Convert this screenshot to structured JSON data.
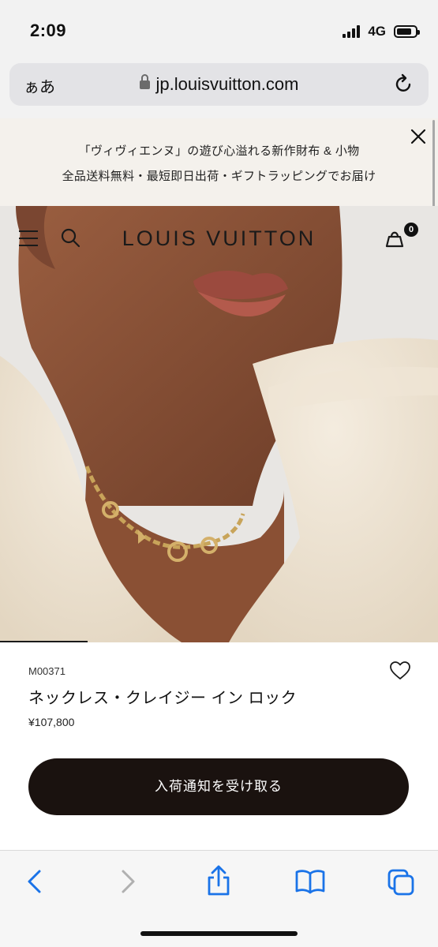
{
  "status_bar": {
    "time": "2:09",
    "network": "4G",
    "signal_bars": 4,
    "battery_level": 0.8
  },
  "browser": {
    "text_size_button": "ぁあ",
    "url": "jp.louisvuitton.com",
    "icons": {
      "lock": "lock-icon",
      "reload": "reload-icon"
    }
  },
  "promo_banner": {
    "line1": "「ヴィヴィエンヌ」の遊び心溢れる新作財布 & 小物",
    "line2": "全品送料無料・最短即日出荷・ギフトラッピングでお届け",
    "close_icon": "close-icon"
  },
  "site_header": {
    "logo": "LOUIS VUITTON",
    "cart_count": "0",
    "icons": {
      "menu": "menu-icon",
      "search": "search-icon",
      "cart": "shopping-bag-icon"
    }
  },
  "hero": {
    "image": "model-wearing-gold-chain-necklace",
    "carousel_progress": 0.2
  },
  "product": {
    "code": "M00371",
    "name": "ネックレス・クレイジー イン ロック",
    "price": "¥107,800",
    "wishlist_icon": "heart-icon",
    "cta_label": "入荷通知を受け取る"
  },
  "toolbar": {
    "items": [
      "back-icon",
      "forward-icon",
      "share-icon",
      "bookmarks-icon",
      "tabs-icon"
    ],
    "accent_color": "#1a73e8",
    "disabled_color": "#b0b0b0"
  }
}
